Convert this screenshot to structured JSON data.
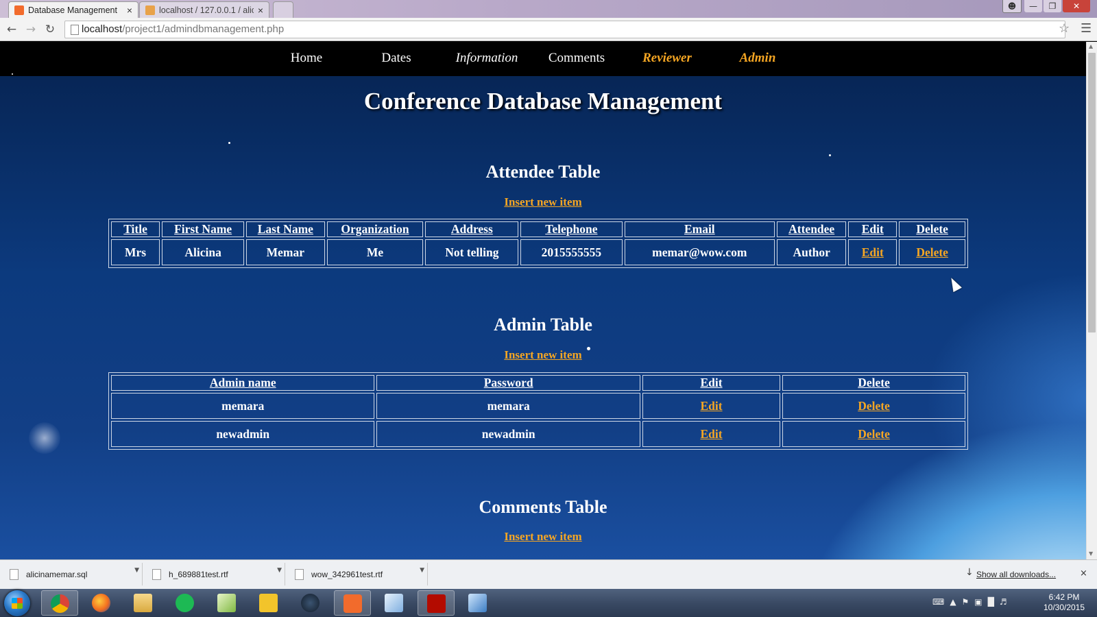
{
  "browser": {
    "tabs": [
      {
        "label": "Database Management",
        "close": "×"
      },
      {
        "label": "localhost / 127.0.0.1 / alici",
        "close": "×"
      }
    ],
    "url_host": "localhost",
    "url_path": "/project1/admindbmanagement.php"
  },
  "nav": {
    "items": [
      "Home",
      "Dates",
      "Information",
      "Comments",
      "Reviewer",
      "Admin"
    ]
  },
  "page_title": "Conference Database Management",
  "attendee": {
    "title": "Attendee Table",
    "insert": "Insert new item",
    "headers": [
      "Title",
      "First Name",
      "Last Name",
      "Organization",
      "Address",
      "Telephone",
      "Email",
      "Attendee",
      "Edit",
      "Delete"
    ],
    "rows": [
      [
        "Mrs",
        "Alicina",
        "Memar",
        "Me",
        "Not telling",
        "2015555555",
        "memar@wow.com",
        "Author",
        "Edit",
        "Delete"
      ]
    ]
  },
  "admin": {
    "title": "Admin Table",
    "insert": "Insert new item",
    "headers": [
      "Admin name",
      "Password",
      "Edit",
      "Delete"
    ],
    "rows": [
      [
        "memara",
        "memara",
        "Edit",
        "Delete"
      ],
      [
        "newadmin",
        "newadmin",
        "Edit",
        "Delete"
      ]
    ]
  },
  "comments": {
    "title": "Comments Table",
    "insert": "Insert new item"
  },
  "downloads": {
    "items": [
      "alicinamemar.sql",
      "h_689881test.rtf",
      "wow_342961test.rtf"
    ],
    "show_all": "Show all downloads...",
    "close": "×"
  },
  "taskbar": {
    "time": "6:42 PM",
    "date": "10/30/2015",
    "apps": [
      "chrome-icon",
      "firefox-icon",
      "explorer-icon",
      "spotify-icon",
      "notepad-icon",
      "live-icon",
      "steam-icon",
      "xampp-icon",
      "cube-icon",
      "acrobat-icon",
      "control-panel-icon"
    ]
  },
  "colors": {
    "accent_gold": "#f5a623",
    "navbar_bg": "#000000",
    "page_bg": "#0c3a7e"
  }
}
